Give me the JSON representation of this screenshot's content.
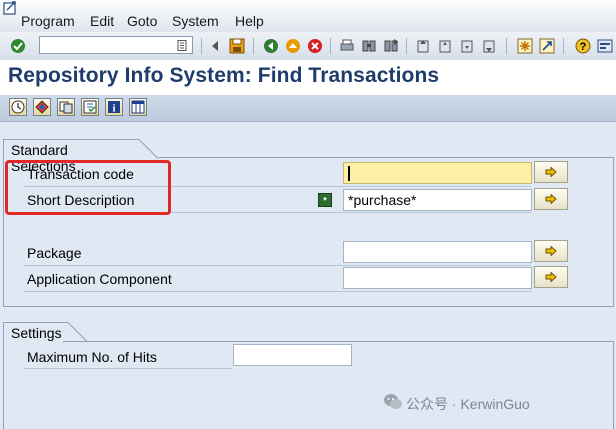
{
  "menubar": {
    "items": [
      "Program",
      "Edit",
      "Goto",
      "System",
      "Help"
    ]
  },
  "toolbar": {
    "command_field_value": ""
  },
  "title": "Repository Info System: Find Transactions",
  "standard_selections": {
    "group_title": "Standard Selections",
    "fields": [
      {
        "label": "Transaction code",
        "value": ""
      },
      {
        "label": "Short Description",
        "value": "*purchase*"
      },
      {
        "label": "Package",
        "value": ""
      },
      {
        "label": "Application Component",
        "value": ""
      }
    ]
  },
  "settings": {
    "group_title": "Settings",
    "max_hits_label": "Maximum No. of Hits",
    "max_hits_value": ""
  },
  "watermark": {
    "text": "公众号 · KerwinGuo"
  },
  "colors": {
    "title": "#1e3d6b",
    "highlight": "#e32626",
    "required_field": "#fdf0a6",
    "background": "#dfe8f3"
  }
}
